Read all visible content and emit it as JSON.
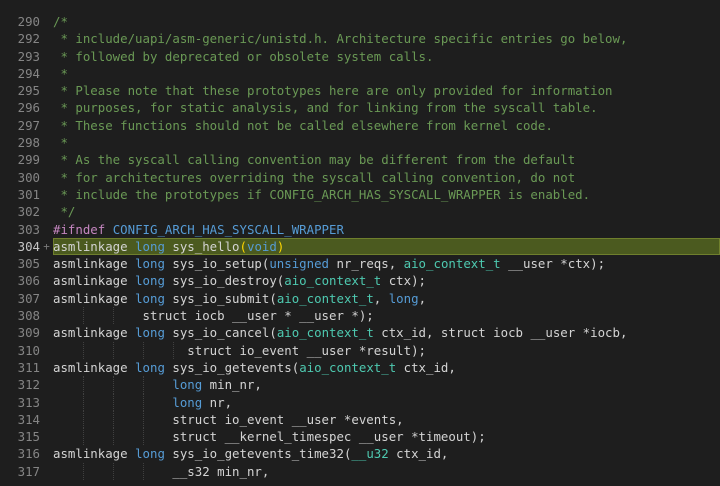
{
  "editor": {
    "active_line": "304",
    "lines": [
      {
        "num": "290",
        "fold": "",
        "tokens": [
          {
            "t": "/*",
            "c": "c"
          }
        ]
      },
      {
        "num": "292",
        "fold": "",
        "tokens": [
          {
            "t": " * include/uapi/asm-generic/unistd.h. Architecture specific entries go below,",
            "c": "c"
          }
        ]
      },
      {
        "num": "293",
        "fold": "",
        "tokens": [
          {
            "t": " * followed by deprecated or obsolete system calls.",
            "c": "c"
          }
        ]
      },
      {
        "num": "294",
        "fold": "",
        "tokens": [
          {
            "t": " *",
            "c": "c"
          }
        ]
      },
      {
        "num": "295",
        "fold": "",
        "tokens": [
          {
            "t": " * Please note that these prototypes here are only provided for information",
            "c": "c"
          }
        ]
      },
      {
        "num": "296",
        "fold": "",
        "tokens": [
          {
            "t": " * purposes, for static analysis, and for linking from the syscall table.",
            "c": "c"
          }
        ]
      },
      {
        "num": "297",
        "fold": "",
        "tokens": [
          {
            "t": " * These functions should not be called elsewhere from kernel code.",
            "c": "c"
          }
        ]
      },
      {
        "num": "298",
        "fold": "",
        "tokens": [
          {
            "t": " *",
            "c": "c"
          }
        ]
      },
      {
        "num": "299",
        "fold": "",
        "tokens": [
          {
            "t": " * As the syscall calling convention may be different from the default",
            "c": "c"
          }
        ]
      },
      {
        "num": "300",
        "fold": "",
        "tokens": [
          {
            "t": " * for architectures overriding the syscall calling convention, do not",
            "c": "c"
          }
        ]
      },
      {
        "num": "301",
        "fold": "",
        "tokens": [
          {
            "t": " * include the prototypes if CONFIG_ARCH_HAS_SYSCALL_WRAPPER is enabled.",
            "c": "c"
          }
        ]
      },
      {
        "num": "302",
        "fold": "",
        "tokens": [
          {
            "t": " */",
            "c": "c"
          }
        ]
      },
      {
        "num": "303",
        "fold": "",
        "tokens": [
          {
            "t": "#ifndef",
            "c": "p"
          },
          {
            "t": " ",
            "c": ""
          },
          {
            "t": "CONFIG_ARCH_HAS_SYSCALL_WRAPPER",
            "c": "m"
          }
        ]
      },
      {
        "num": "304",
        "fold": "+",
        "tokens": [
          {
            "t": "asmlinkage ",
            "c": ""
          },
          {
            "t": "long",
            "c": "k"
          },
          {
            "t": " sys_hello",
            "c": ""
          },
          {
            "t": "(",
            "c": "br"
          },
          {
            "t": "void",
            "c": "k"
          },
          {
            "t": ")",
            "c": "br"
          }
        ]
      },
      {
        "num": "305",
        "fold": "",
        "tokens": [
          {
            "t": "asmlinkage ",
            "c": ""
          },
          {
            "t": "long",
            "c": "k"
          },
          {
            "t": " sys_io_setup(",
            "c": ""
          },
          {
            "t": "unsigned",
            "c": "k"
          },
          {
            "t": " nr_reqs, ",
            "c": ""
          },
          {
            "t": "aio_context_t",
            "c": "t"
          },
          {
            "t": " __user *ctx);",
            "c": ""
          }
        ]
      },
      {
        "num": "306",
        "fold": "",
        "tokens": [
          {
            "t": "asmlinkage ",
            "c": ""
          },
          {
            "t": "long",
            "c": "k"
          },
          {
            "t": " sys_io_destroy(",
            "c": ""
          },
          {
            "t": "aio_context_t",
            "c": "t"
          },
          {
            "t": " ctx);",
            "c": ""
          }
        ]
      },
      {
        "num": "307",
        "fold": "",
        "tokens": [
          {
            "t": "asmlinkage ",
            "c": ""
          },
          {
            "t": "long",
            "c": "k"
          },
          {
            "t": " sys_io_submit(",
            "c": ""
          },
          {
            "t": "aio_context_t",
            "c": "t"
          },
          {
            "t": ", ",
            "c": ""
          },
          {
            "t": "long",
            "c": "k"
          },
          {
            "t": ",",
            "c": ""
          }
        ]
      },
      {
        "num": "308",
        "fold": "",
        "tokens": [
          {
            "t": "            struct iocb __user * __user *);",
            "c": ""
          }
        ]
      },
      {
        "num": "309",
        "fold": "",
        "tokens": [
          {
            "t": "asmlinkage ",
            "c": ""
          },
          {
            "t": "long",
            "c": "k"
          },
          {
            "t": " sys_io_cancel(",
            "c": ""
          },
          {
            "t": "aio_context_t",
            "c": "t"
          },
          {
            "t": " ctx_id, struct iocb __user *iocb,",
            "c": ""
          }
        ]
      },
      {
        "num": "310",
        "fold": "",
        "tokens": [
          {
            "t": "                  struct io_event __user *result);",
            "c": ""
          }
        ]
      },
      {
        "num": "311",
        "fold": "",
        "tokens": [
          {
            "t": "asmlinkage ",
            "c": ""
          },
          {
            "t": "long",
            "c": "k"
          },
          {
            "t": " sys_io_getevents(",
            "c": ""
          },
          {
            "t": "aio_context_t",
            "c": "t"
          },
          {
            "t": " ctx_id,",
            "c": ""
          }
        ]
      },
      {
        "num": "312",
        "fold": "",
        "tokens": [
          {
            "t": "                ",
            "c": ""
          },
          {
            "t": "long",
            "c": "k"
          },
          {
            "t": " min_nr,",
            "c": ""
          }
        ]
      },
      {
        "num": "313",
        "fold": "",
        "tokens": [
          {
            "t": "                ",
            "c": ""
          },
          {
            "t": "long",
            "c": "k"
          },
          {
            "t": " nr,",
            "c": ""
          }
        ]
      },
      {
        "num": "314",
        "fold": "",
        "tokens": [
          {
            "t": "                struct io_event __user *events,",
            "c": ""
          }
        ]
      },
      {
        "num": "315",
        "fold": "",
        "tokens": [
          {
            "t": "                struct __kernel_timespec __user *timeout);",
            "c": ""
          }
        ]
      },
      {
        "num": "316",
        "fold": "",
        "tokens": [
          {
            "t": "asmlinkage ",
            "c": ""
          },
          {
            "t": "long",
            "c": "k"
          },
          {
            "t": " sys_io_getevents_time32(",
            "c": ""
          },
          {
            "t": "__u32",
            "c": "t"
          },
          {
            "t": " ctx_id,",
            "c": ""
          }
        ]
      },
      {
        "num": "317",
        "fold": "",
        "tokens": [
          {
            "t": "                __s32 min_nr,",
            "c": ""
          }
        ]
      }
    ]
  }
}
